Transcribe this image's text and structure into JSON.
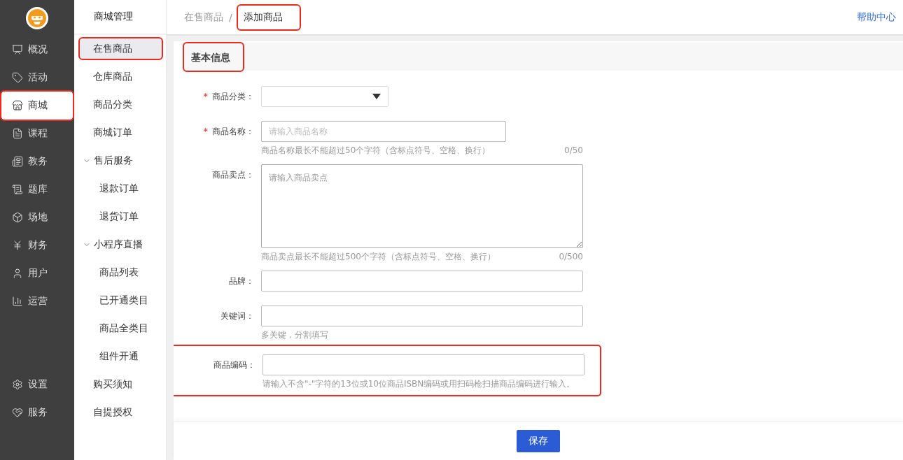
{
  "nav": {
    "items": [
      {
        "label": "概况",
        "selected": false,
        "annotated": false
      },
      {
        "label": "活动",
        "selected": false,
        "annotated": false
      },
      {
        "label": "商城",
        "selected": true,
        "annotated": true
      },
      {
        "label": "课程",
        "selected": false,
        "annotated": false
      },
      {
        "label": "教务",
        "selected": false,
        "annotated": false
      },
      {
        "label": "题库",
        "selected": false,
        "annotated": false
      },
      {
        "label": "场地",
        "selected": false,
        "annotated": false
      },
      {
        "label": "财务",
        "selected": false,
        "annotated": false
      },
      {
        "label": "用户",
        "selected": false,
        "annotated": false
      },
      {
        "label": "运营",
        "selected": false,
        "annotated": false
      }
    ],
    "bottom_items": [
      {
        "label": "设置",
        "selected": false
      },
      {
        "label": "服务",
        "selected": false
      }
    ]
  },
  "subnav": {
    "title": "商城管理",
    "items": [
      {
        "label": "在售商品",
        "selected": true,
        "annotated": true
      },
      {
        "label": "仓库商品",
        "selected": false,
        "annotated": false
      },
      {
        "label": "商品分类",
        "selected": false,
        "annotated": false
      },
      {
        "label": "商城订单",
        "selected": false,
        "annotated": false
      },
      {
        "label": "售后服务",
        "selected": false,
        "annotated": false,
        "expanded": true,
        "children": [
          {
            "label": "退款订单",
            "selected": false
          },
          {
            "label": "退货订单",
            "selected": false
          }
        ]
      },
      {
        "label": "小程序直播",
        "selected": false,
        "annotated": false,
        "expanded": true,
        "children": [
          {
            "label": "商品列表",
            "selected": false
          },
          {
            "label": "已开通类目",
            "selected": false
          },
          {
            "label": "商品全类目",
            "selected": false
          },
          {
            "label": "组件开通",
            "selected": false
          }
        ]
      },
      {
        "label": "购买须知",
        "selected": false,
        "annotated": false
      },
      {
        "label": "自提授权",
        "selected": false,
        "annotated": false
      }
    ]
  },
  "header": {
    "breadcrumb": [
      {
        "label": "在售商品",
        "annotated": false
      },
      {
        "label": "添加商品",
        "annotated": true
      }
    ],
    "separator": "/",
    "help_link": "帮助中心"
  },
  "section": {
    "title": "基本信息",
    "annotated": true
  },
  "form": {
    "fields": [
      {
        "kind": "select",
        "label": "商品分类：",
        "required_mark": "*",
        "annotated": false
      },
      {
        "kind": "short_input",
        "label": "商品名称：",
        "required_mark": "*",
        "annotated": false,
        "placeholder": "请输入商品名称",
        "hint": "商品名称最长不能超过50个字符（含标点符号、空格、换行）",
        "counter": "0/50"
      },
      {
        "kind": "textarea",
        "label": "商品卖点：",
        "annotated": false,
        "placeholder": "请输入商品卖点",
        "hint": "商品卖点最长不能超过500个字符（含标点符号、空格、换行）",
        "counter": "0/500"
      },
      {
        "kind": "input",
        "label": "品牌：",
        "annotated": false
      },
      {
        "kind": "input",
        "label": "关键词：",
        "annotated": false,
        "hint": "多关键，分割填写"
      },
      {
        "kind": "input",
        "label": "商品编码：",
        "annotated": true,
        "hint": "请输入不含\"-\"字符的13位或10位商品ISBN编码或用扫码枪扫描商品编码进行输入。"
      }
    ]
  },
  "footer": {
    "save_button": "保存"
  }
}
